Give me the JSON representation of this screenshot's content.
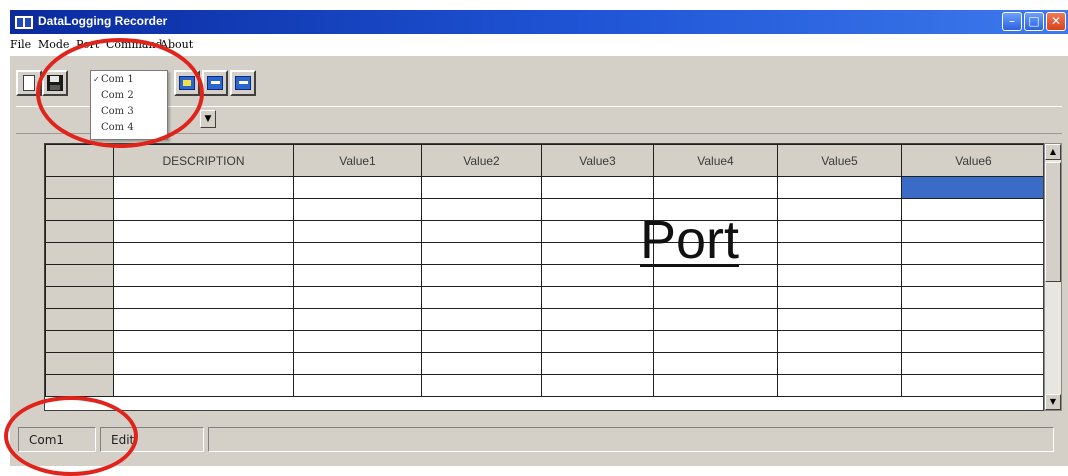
{
  "window": {
    "title": "DataLogging Recorder",
    "min_glyph": "–",
    "max_glyph": "□",
    "close_glyph": "✕"
  },
  "menubar": {
    "items": [
      "File",
      "Mode",
      "Port",
      "Command",
      "About"
    ]
  },
  "port_menu": {
    "items": [
      {
        "label": "Com 1",
        "checked": true
      },
      {
        "label": "Com 2",
        "checked": false
      },
      {
        "label": "Com 3",
        "checked": false
      },
      {
        "label": "Com 4",
        "checked": false
      }
    ],
    "check_glyph": "✓"
  },
  "toolbar": {
    "icons": [
      "new-file-icon",
      "save-icon",
      "open-folder-icon",
      "transfer-icon",
      "export-icon"
    ]
  },
  "combo": {
    "arrow_glyph": "▼"
  },
  "grid": {
    "columns": [
      "DESCRIPTION",
      "Value1",
      "Value2",
      "Value3",
      "Value4",
      "Value5",
      "Value6"
    ],
    "row_count": 10,
    "selected_cell": {
      "row": 0,
      "column": "Value6"
    }
  },
  "scrollbar": {
    "up_glyph": "▲",
    "down_glyph": "▼"
  },
  "annotation": {
    "port_label": "Port"
  },
  "statusbar": {
    "port": "Com1",
    "mode": "Edit",
    "info": ""
  },
  "colors": {
    "title_bar": "#1f55d6",
    "face": "#d4d0c8",
    "selection": "#3a6cc7",
    "annotation_ring": "#e0241b"
  }
}
